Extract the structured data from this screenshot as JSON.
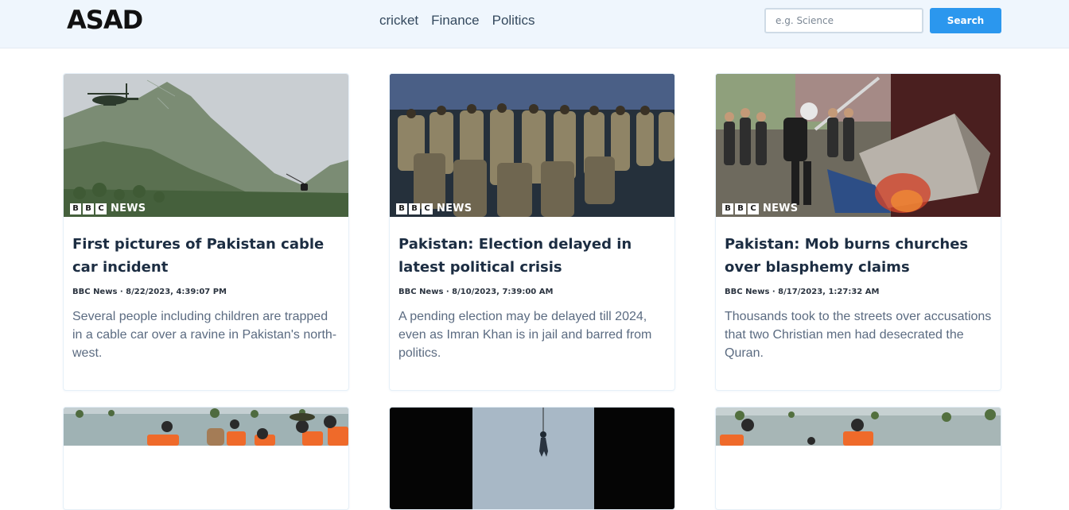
{
  "header": {
    "logo_text": "ASAD",
    "nav": [
      "cricket",
      "Finance",
      "Politics"
    ],
    "search": {
      "placeholder": "e.g. Science",
      "value": "",
      "button_label": "Search"
    }
  },
  "colors": {
    "accent": "#2b97ee",
    "header_bg": "#eff6fd",
    "title": "#1c2d42",
    "description": "#5b6b81"
  },
  "brand_badge": {
    "blocks": [
      "B",
      "B",
      "C"
    ],
    "label": "NEWS"
  },
  "articles": [
    {
      "title": "First pictures of Pakistan cable car incident",
      "source": "BBC News",
      "date": "8/22/2023, 4:39:07 PM",
      "description": "Several people including children are trapped in a cable car over a ravine in Pakistan's north-west.",
      "image": "helicopter-over-mountain"
    },
    {
      "title": "Pakistan: Election delayed in latest political crisis",
      "source": "BBC News",
      "date": "8/10/2023, 7:39:00 AM",
      "description": "A pending election may be delayed till 2024, even as Imran Khan is in jail and barred from politics.",
      "image": "soldiers-marching"
    },
    {
      "title": "Pakistan: Mob burns churches over blasphemy claims",
      "source": "BBC News",
      "date": "8/17/2023, 1:27:32 AM",
      "description": "Thousands took to the streets over accusations that two Christian men had desecrated the Quran.",
      "image": "mob-street-fire"
    },
    {
      "image": "flood-rescue-boat"
    },
    {
      "image": "helicopter-winch-rescue"
    },
    {
      "image": "flooded-fields"
    }
  ]
}
